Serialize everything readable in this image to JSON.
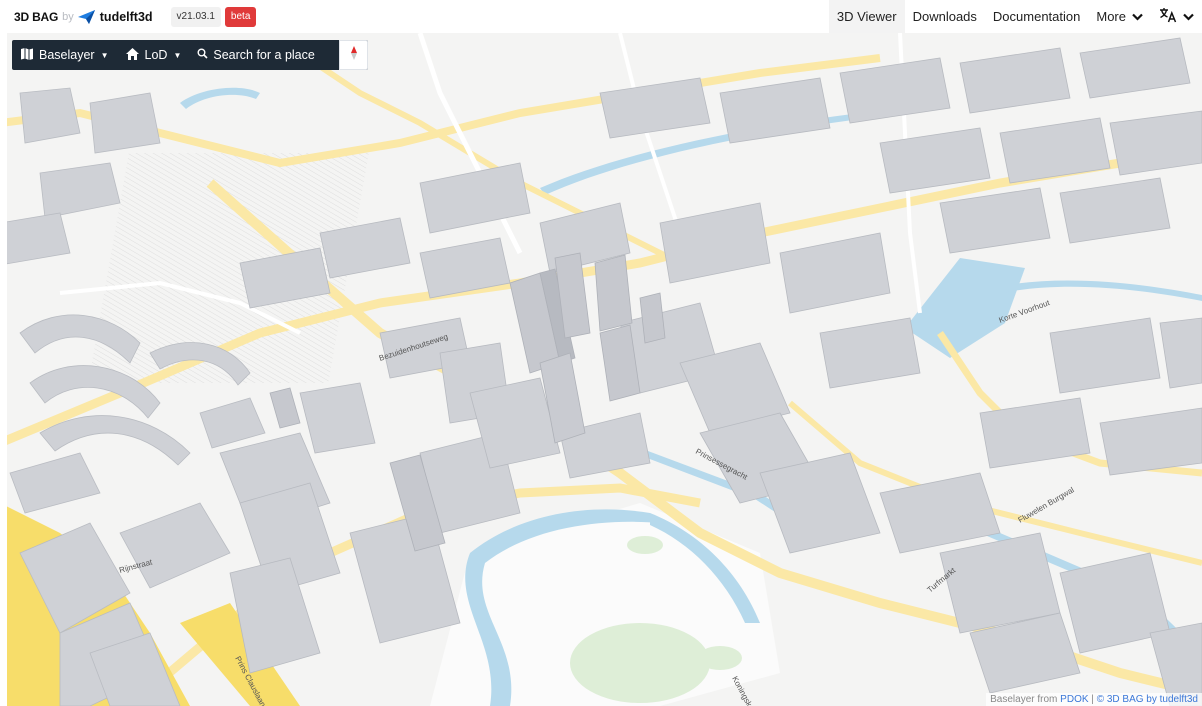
{
  "brand": {
    "name": "3D BAG",
    "by": "by",
    "org": "tudelft3d",
    "version": "v21.03.1",
    "badge": "beta"
  },
  "nav": {
    "items": [
      "3D Viewer",
      "Downloads",
      "Documentation",
      "More"
    ],
    "active": "3D Viewer"
  },
  "icons": {
    "logo": "paper-plane-icon",
    "more": "chevron-down-icon",
    "language": "translate-icon",
    "baselayer": "map-icon",
    "lod": "home-icon",
    "search": "search-icon",
    "compass": "compass-icon"
  },
  "toolbar": {
    "baselayer": "Baselayer",
    "lod": "LoD",
    "search_placeholder": "Search for a place"
  },
  "map": {
    "street_labels": [
      "Prins Clauslaan",
      "Koningskade",
      "Bezuidenhoutseweg",
      "Prinsessegracht",
      "Korte Voorhout",
      "Fluwelen Burgwal",
      "Turfmarkt",
      "Rijnstraat"
    ]
  },
  "attribution": {
    "prefix": "Baselayer from",
    "pdok": "PDOK",
    "sep": "|",
    "bag": "© 3D BAG by tudelft3d"
  },
  "colors": {
    "toolbar_bg": "#1e2a36",
    "badge": "#e03a3a",
    "road": "#fbe8a6",
    "major_road": "#f7dd6a",
    "water": "#b6d9ec",
    "park": "#deeed7",
    "building": "#cfd1d6",
    "link": "#3b78d8"
  }
}
